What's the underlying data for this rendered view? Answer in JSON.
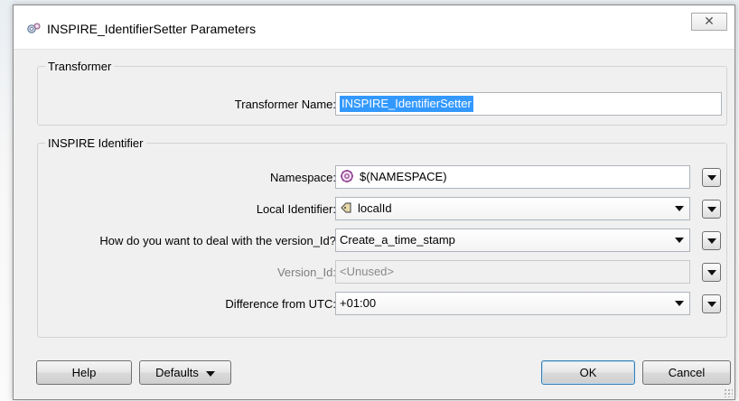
{
  "window": {
    "title": "INSPIRE_IdentifierSetter Parameters",
    "close_glyph": "✕",
    "icon": "gear-icon"
  },
  "transformer_group": {
    "title": "Transformer",
    "name_label": "Transformer Name:",
    "name_value": "INSPIRE_IdentifierSetter"
  },
  "identifier_group": {
    "title": "INSPIRE Identifier",
    "namespace": {
      "label": "Namespace:",
      "value": "$(NAMESPACE)",
      "icon": "user-parameter-icon"
    },
    "local_identifier": {
      "label": "Local Identifier:",
      "value": "localId",
      "icon": "attribute-icon"
    },
    "version_mode": {
      "label": "How do you want to deal with the version_Id?",
      "value": "Create_a_time_stamp"
    },
    "version_id": {
      "label": "Version_Id:",
      "value": "<Unused>",
      "enabled": false
    },
    "utc_offset": {
      "label": "Difference from UTC:",
      "value": "+01:00"
    }
  },
  "buttons": {
    "help": "Help",
    "defaults": "Defaults",
    "ok": "OK",
    "cancel": "Cancel"
  },
  "colors": {
    "selection": "#3399ff",
    "dialog_bg": "#f0f0f0"
  }
}
